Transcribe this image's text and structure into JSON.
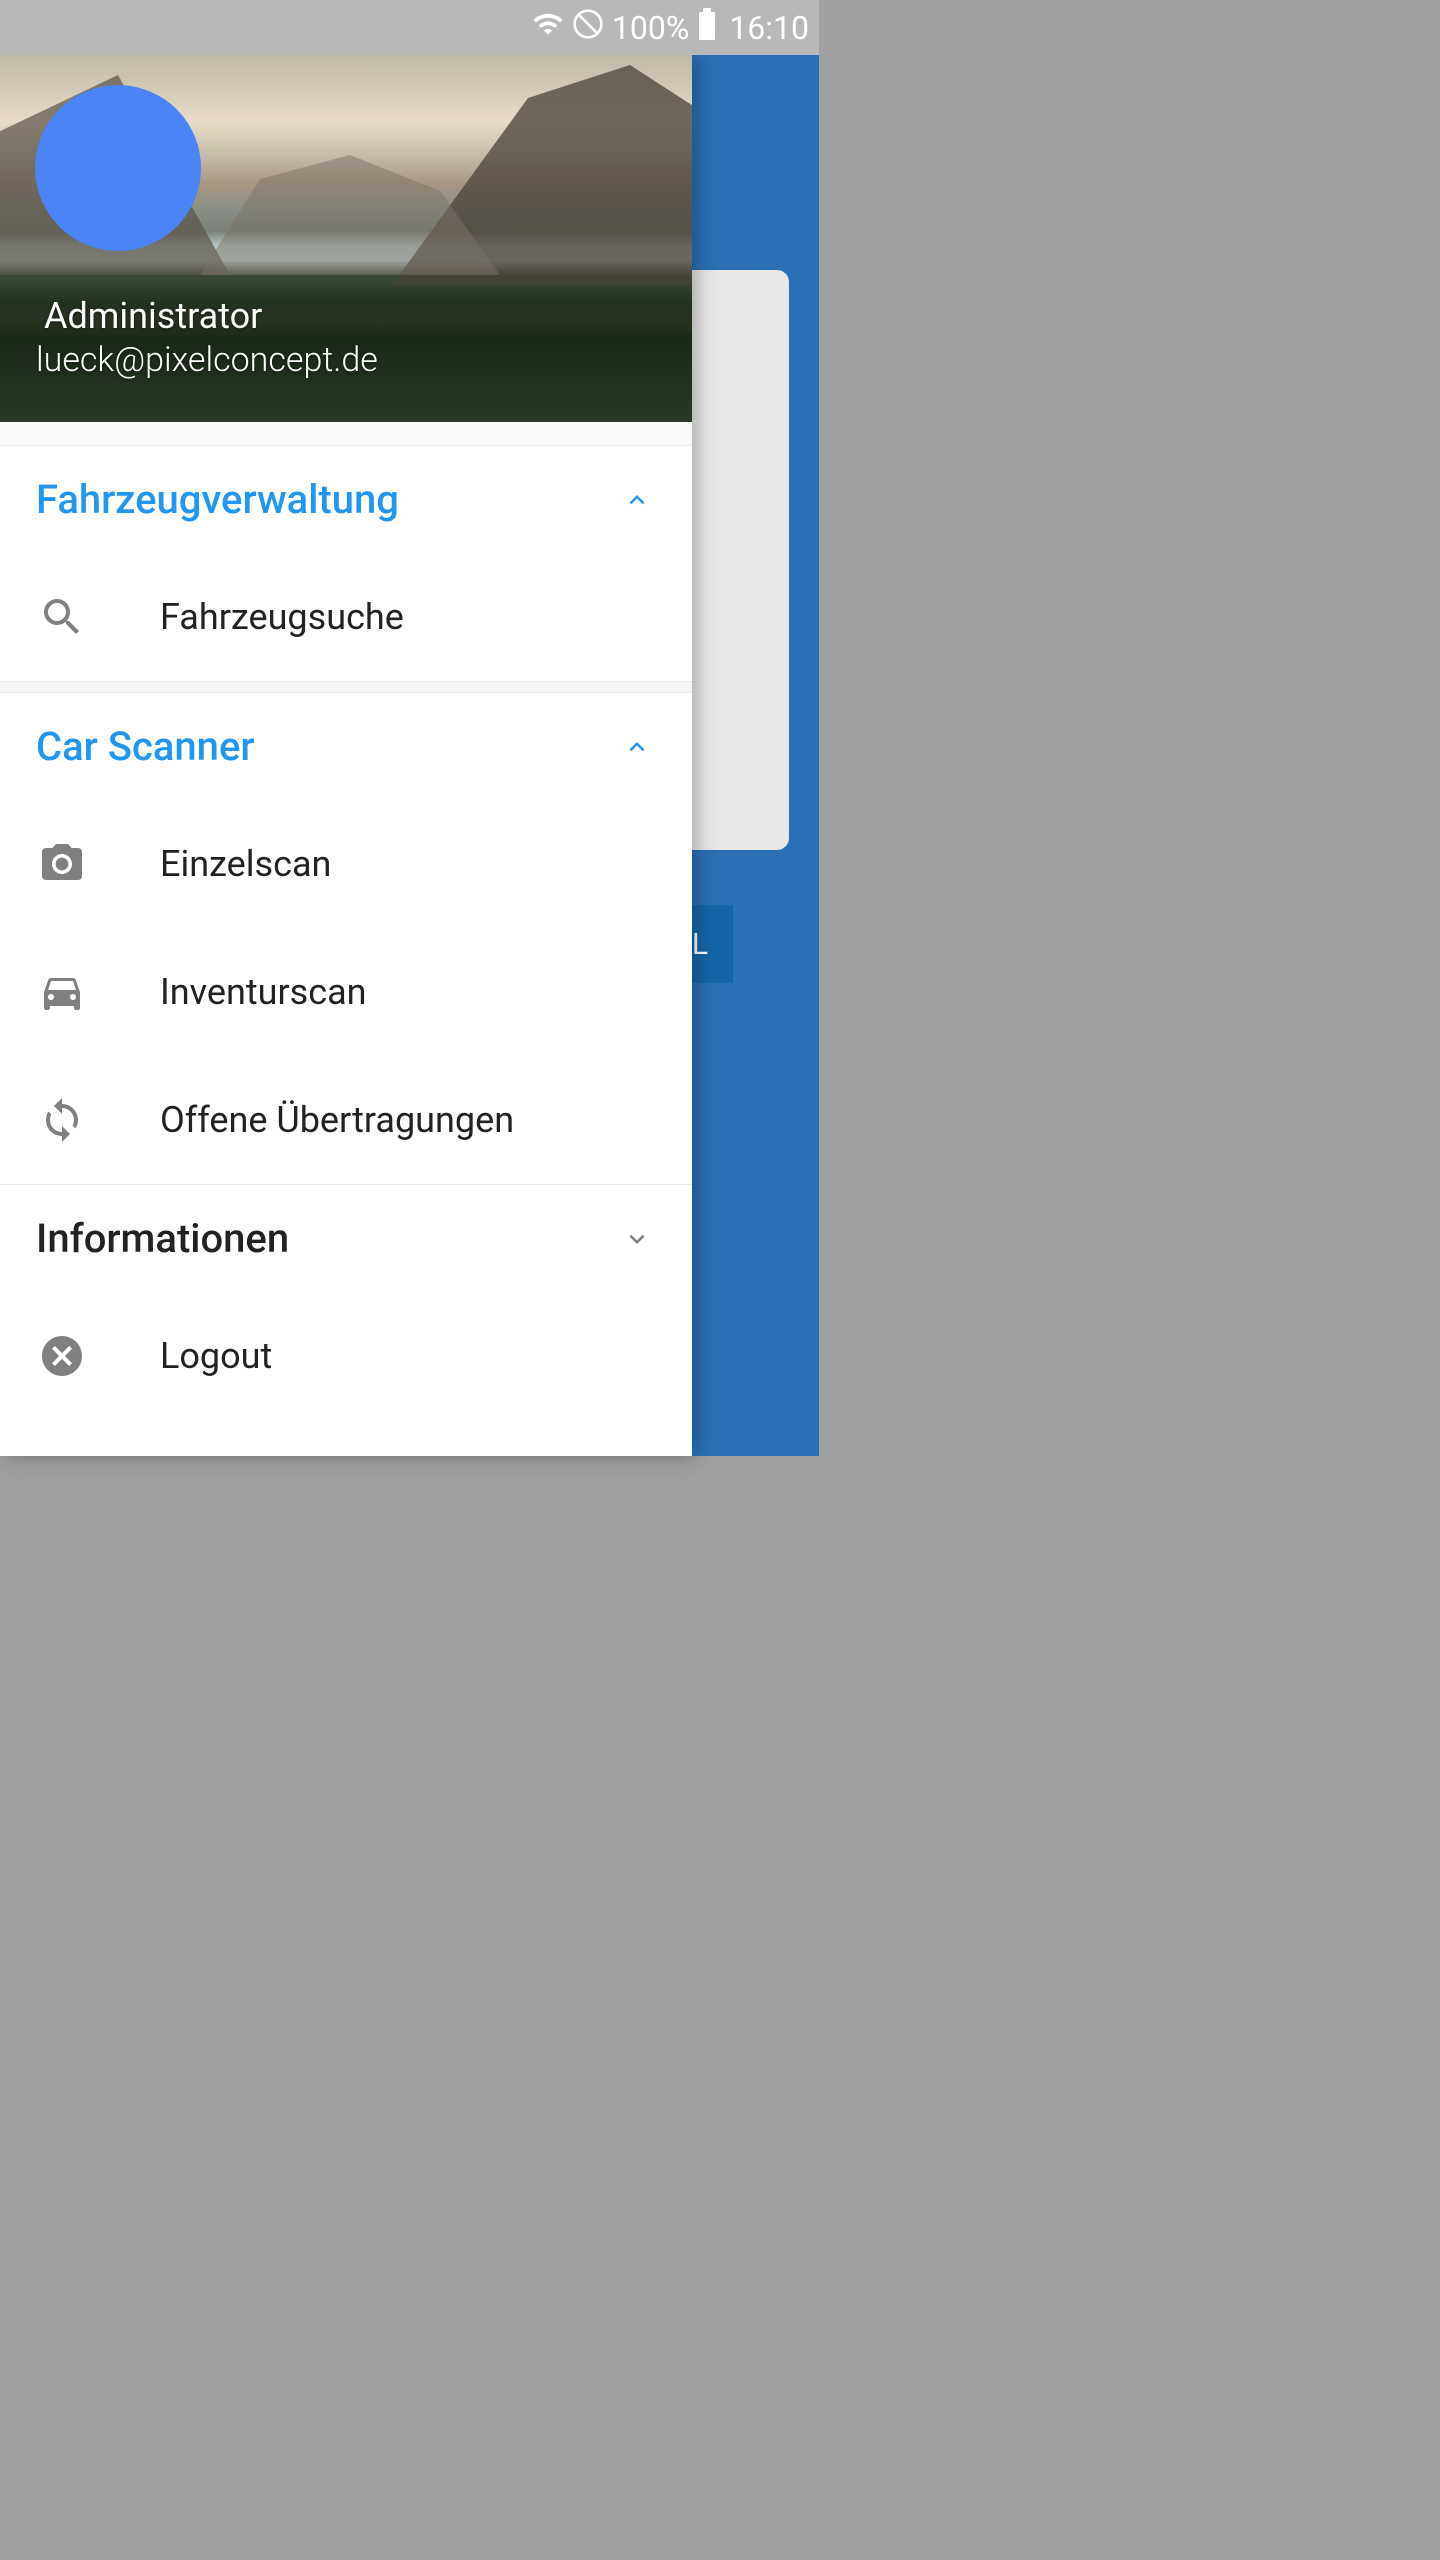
{
  "status_bar": {
    "battery_pct": "100%",
    "time": "16:10"
  },
  "background": {
    "button_text": "L"
  },
  "drawer": {
    "user": {
      "name": "Administrator",
      "email": "lueck@pixelconcept.de"
    },
    "sections": {
      "fahrzeugverwaltung": {
        "title": "Fahrzeugverwaltung",
        "items": {
          "fahrzeugsuche": "Fahrzeugsuche"
        }
      },
      "car_scanner": {
        "title": "Car Scanner",
        "items": {
          "einzelscan": "Einzelscan",
          "inventurscan": "Inventurscan",
          "offene_uebertragungen": "Offene Übertragungen"
        }
      },
      "informationen": {
        "title": "Informationen"
      }
    },
    "logout": "Logout"
  }
}
